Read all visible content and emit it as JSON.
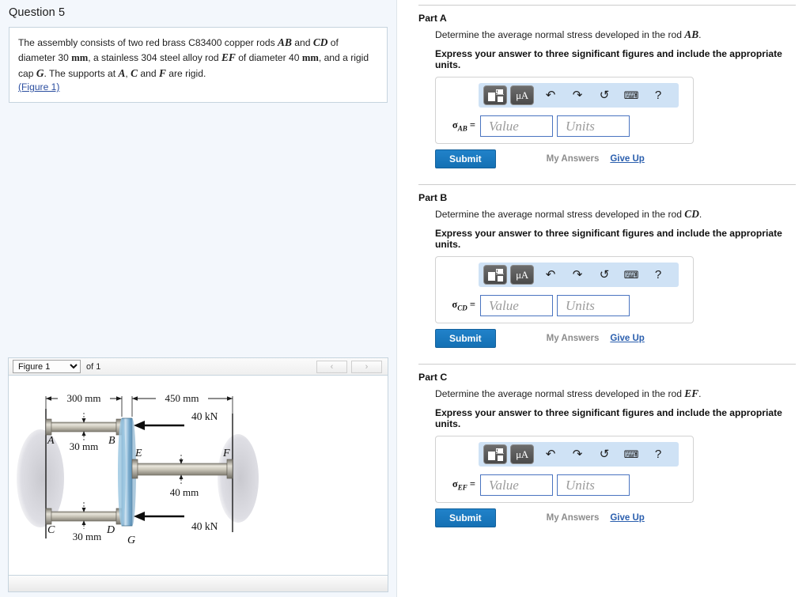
{
  "question": {
    "title": "Question 5",
    "body_pre": "The assembly consists of two red brass C83400 copper rods ",
    "rod1": "AB",
    "body_and": " and ",
    "rod2": "CD",
    "body_mid": " of diameter 30 ",
    "unit1": "mm",
    "body_mid2": ", a stainless 304 steel alloy rod ",
    "rod3": "EF",
    "body_mid3": " of diameter 40 ",
    "unit2": "mm",
    "body_mid4": ", and a rigid cap ",
    "cap": "G",
    "body_mid5": ". The supports at ",
    "pt1": "A",
    "sep1": ", ",
    "pt2": "C",
    "sep2": " and ",
    "pt3": "F",
    "body_end": " are rigid.",
    "figure_link": "(Figure 1)"
  },
  "figure_panel": {
    "selected_figure": "Figure 1",
    "options": [
      "Figure 1"
    ],
    "of_label": "of 1",
    "prev_icon": "‹",
    "next_icon": "›"
  },
  "figure_diagram": {
    "dim_left": "300 mm",
    "dim_right": "450 mm",
    "dia_top": "30 mm",
    "dia_bottom": "30 mm",
    "dia_mid": "40 mm",
    "load_top": "40 kN",
    "load_bottom": "40 kN",
    "labels": {
      "A": "A",
      "B": "B",
      "C": "C",
      "D": "D",
      "E": "E",
      "F": "F",
      "G": "G"
    }
  },
  "toolbar": {
    "template_icon": "math-template-icon",
    "units_label": "μA",
    "units_ring": "°",
    "undo_icon": "↶",
    "redo_icon": "↷",
    "reset_icon": "↺",
    "keyboard_icon": "⌨",
    "help_icon": "?"
  },
  "common": {
    "instruction": "Express your answer to three significant figures and include the appropriate units.",
    "value_placeholder": "Value",
    "units_placeholder": "Units",
    "submit_label": "Submit",
    "my_answers_label": "My Answers",
    "give_up_label": "Give Up"
  },
  "parts": [
    {
      "label": "Part A",
      "question_pre": "Determine the average normal stress developed in the rod ",
      "rod": "AB",
      "question_post": ".",
      "sigma": "σ",
      "sigma_sub": "AB",
      "equals": " ="
    },
    {
      "label": "Part B",
      "question_pre": "Determine the average normal stress developed in the rod ",
      "rod": "CD",
      "question_post": ".",
      "sigma": "σ",
      "sigma_sub": "CD",
      "equals": " ="
    },
    {
      "label": "Part C",
      "question_pre": "Determine the average normal stress developed in the rod ",
      "rod": "EF",
      "question_post": ".",
      "sigma": "σ",
      "sigma_sub": "EF",
      "equals": " ="
    }
  ],
  "colors": {
    "accent_blue": "#1470b4",
    "link_blue": "#2b5fae",
    "toolbar_bg": "#cfe2f5",
    "input_border": "#4a74c0",
    "panel_bg": "#f3f7fc"
  }
}
